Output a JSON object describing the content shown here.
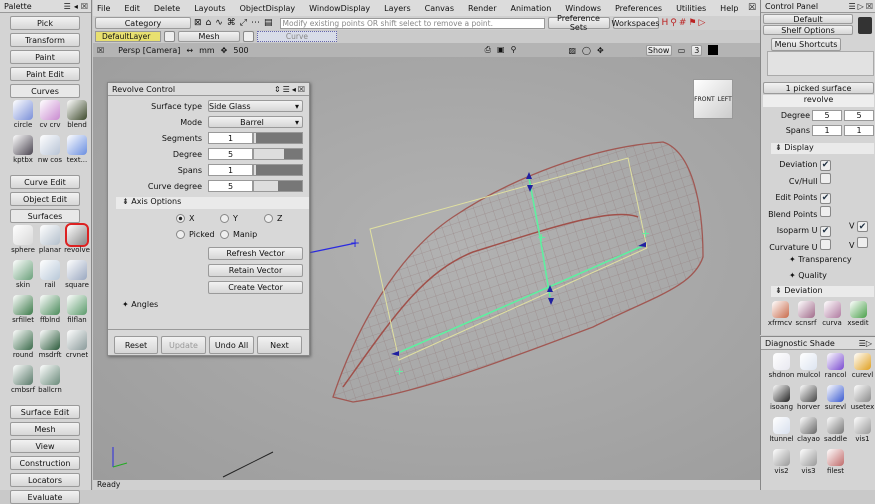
{
  "palette": {
    "title": "Palette",
    "sections_top": [
      "Pick",
      "Transform",
      "Paint",
      "Paint Edit"
    ],
    "curves": {
      "label": "Curves",
      "tools": [
        {
          "label": "circle",
          "color": "#7a8fd8"
        },
        {
          "label": "cv crv",
          "color": "#c98ad0"
        },
        {
          "label": "blend",
          "color": "#3d4a2c"
        },
        {
          "label": "kptbx",
          "color": "#4a4450"
        },
        {
          "label": "nw cos",
          "color": "#b8c4d6"
        },
        {
          "label": "text...",
          "color": "#6a8ee0"
        }
      ]
    },
    "mid_sections": [
      "Curve Edit",
      "Object Edit"
    ],
    "surfaces": {
      "label": "Surfaces",
      "tools": [
        {
          "label": "sphere",
          "color": "#d8d8d8"
        },
        {
          "label": "planar",
          "color": "#b4c0cc"
        },
        {
          "label": "revolve",
          "color": "#888",
          "selected": true
        },
        {
          "label": "skin",
          "color": "#6aa07a"
        },
        {
          "label": "rail",
          "color": "#b8c8d8"
        },
        {
          "label": "square",
          "color": "#9aa8c0"
        },
        {
          "label": "srfillet",
          "color": "#3c7a4a"
        },
        {
          "label": "ffblnd",
          "color": "#4a8a5a"
        },
        {
          "label": "filflan",
          "color": "#5a9a6a"
        },
        {
          "label": "round",
          "color": "#3a6a4a"
        },
        {
          "label": "msdrft",
          "color": "#2a5a3a"
        },
        {
          "label": "crvnet",
          "color": "#8a9a9a"
        },
        {
          "label": "cmbsrf",
          "color": "#5a7a6a"
        },
        {
          "label": "ballcrn",
          "color": "#6a8a7a"
        }
      ]
    },
    "bottom_sections": [
      "Surface Edit",
      "Mesh",
      "View",
      "Construction",
      "Locators",
      "Evaluate"
    ]
  },
  "menu": [
    "File",
    "Edit",
    "Delete",
    "Layouts",
    "ObjectDisplay",
    "WindowDisplay",
    "Layers",
    "Canvas",
    "Render",
    "Animation",
    "Windows",
    "Preferences",
    "Utilities",
    "Help"
  ],
  "toolbar": {
    "category": "Category",
    "prompt": "Modify existing points OR shift select to remove a point.",
    "preference_sets": "Preference Sets",
    "workspaces": "Workspaces"
  },
  "layers": {
    "default": "DefaultLayer",
    "mesh": "Mesh",
    "curve": "Curve"
  },
  "viewport": {
    "label": "Persp [Camera]",
    "units": "mm",
    "scale": "500",
    "show": "Show",
    "num": "3",
    "cube_front": "FRONT",
    "cube_left": "LEFT"
  },
  "status": "Ready",
  "revolve": {
    "title": "Revolve Control",
    "surface_type_label": "Surface type",
    "surface_type": "Side Glass",
    "mode_label": "Mode",
    "mode": "Barrel",
    "segments_label": "Segments",
    "segments": "1",
    "degree_label": "Degree",
    "degree": "5",
    "spans_label": "Spans",
    "spans": "1",
    "curve_degree_label": "Curve degree",
    "curve_degree": "5",
    "axis_options": "Axis Options",
    "x": "X",
    "y": "Y",
    "z": "Z",
    "picked": "Picked",
    "manip": "Manip",
    "refresh": "Refresh Vector",
    "retain": "Retain Vector",
    "create": "Create Vector",
    "angles": "Angles",
    "reset": "Reset",
    "update": "Update",
    "undo_all": "Undo All",
    "next": "Next"
  },
  "control_panel": {
    "title": "Control Panel",
    "default": "Default",
    "shelf_options": "Shelf Options",
    "menu_shortcuts": "Menu Shortcuts",
    "picked": "1 picked surface",
    "object": "revolve",
    "degree_label": "Degree",
    "degree_u": "5",
    "degree_v": "5",
    "spans_label": "Spans",
    "spans_u": "1",
    "spans_v": "1",
    "display": "Display",
    "deviation_label": "Deviation",
    "cvhull": "Cv/Hull",
    "edit_points": "Edit Points",
    "blend_points": "Blend Points",
    "isoparm_u": "Isoparm U",
    "curvature_u": "Curvature U",
    "v": "V",
    "transparency": "Transparency",
    "quality": "Quality",
    "deviation_section": "Deviation",
    "shelf": [
      {
        "label": "xfrmcv",
        "color": "#c86a4a"
      },
      {
        "label": "scnsrf",
        "color": "#a06a8a"
      },
      {
        "label": "curva",
        "color": "#b07aa0"
      },
      {
        "label": "xsedit",
        "color": "#4aa04a"
      }
    ]
  },
  "diagnostic": {
    "title": "Diagnostic Shade",
    "items": [
      {
        "label": "shdnon",
        "color": "#e8e8f0"
      },
      {
        "label": "mulcol",
        "color": "#dde4f0"
      },
      {
        "label": "rancol",
        "color": "#7a4ad0"
      },
      {
        "label": "curevl",
        "color": "#e0a020"
      },
      {
        "label": "isoang",
        "color": "#222"
      },
      {
        "label": "horver",
        "color": "#444"
      },
      {
        "label": "surevl",
        "color": "#3a5ad0"
      },
      {
        "label": "usetex",
        "color": "#888"
      },
      {
        "label": "ltunnel",
        "color": "#d8e0ee"
      },
      {
        "label": "clayao",
        "color": "#666"
      },
      {
        "label": "saddle",
        "color": "#777"
      },
      {
        "label": "vis1",
        "color": "#999"
      },
      {
        "label": "vis2",
        "color": "#999"
      },
      {
        "label": "vis3",
        "color": "#999"
      },
      {
        "label": "filest",
        "color": "#c06a6a"
      }
    ]
  }
}
